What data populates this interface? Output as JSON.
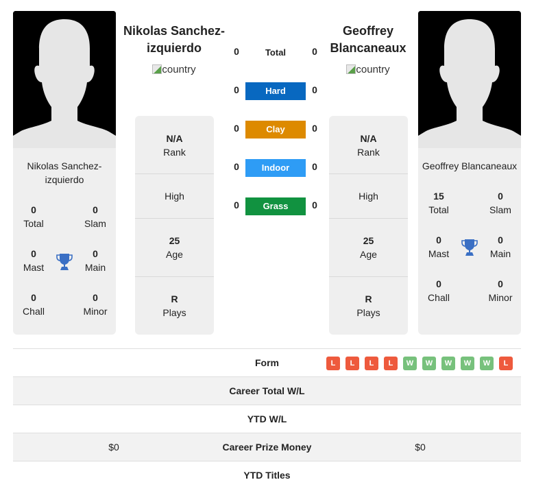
{
  "player1": {
    "name": "Nikolas Sanchez-izquierdo",
    "name_line1": "Nikolas Sanchez-",
    "name_line2": "izquierdo",
    "country_alt": "country",
    "stats": {
      "total": {
        "value": "0",
        "label": "Total"
      },
      "slam": {
        "value": "0",
        "label": "Slam"
      },
      "mast": {
        "value": "0",
        "label": "Mast"
      },
      "main": {
        "value": "0",
        "label": "Main"
      },
      "chall": {
        "value": "0",
        "label": "Chall"
      },
      "minor": {
        "value": "0",
        "label": "Minor"
      }
    },
    "info": {
      "rank": {
        "value": "N/A",
        "label": "Rank"
      },
      "high": {
        "value": "",
        "label": "High"
      },
      "age": {
        "value": "25",
        "label": "Age"
      },
      "plays": {
        "value": "R",
        "label": "Plays"
      }
    }
  },
  "player2": {
    "name": "Geoffrey Blancaneaux",
    "name_line1": "Geoffrey",
    "name_line2": "Blancaneaux",
    "country_alt": "country",
    "stats": {
      "total": {
        "value": "15",
        "label": "Total"
      },
      "slam": {
        "value": "0",
        "label": "Slam"
      },
      "mast": {
        "value": "0",
        "label": "Mast"
      },
      "main": {
        "value": "0",
        "label": "Main"
      },
      "chall": {
        "value": "0",
        "label": "Chall"
      },
      "minor": {
        "value": "0",
        "label": "Minor"
      }
    },
    "info": {
      "rank": {
        "value": "N/A",
        "label": "Rank"
      },
      "high": {
        "value": "",
        "label": "High"
      },
      "age": {
        "value": "25",
        "label": "Age"
      },
      "plays": {
        "value": "R",
        "label": "Plays"
      }
    }
  },
  "h2h": {
    "total": {
      "label": "Total",
      "p1": "0",
      "p2": "0"
    },
    "surfaces": [
      {
        "label": "Hard",
        "p1": "0",
        "p2": "0",
        "color": "#0868c0"
      },
      {
        "label": "Clay",
        "p1": "0",
        "p2": "0",
        "color": "#dd8a00"
      },
      {
        "label": "Indoor",
        "p1": "0",
        "p2": "0",
        "color": "#2e9cf5"
      },
      {
        "label": "Grass",
        "p1": "0",
        "p2": "0",
        "color": "#119240"
      }
    ]
  },
  "comparison": {
    "form": {
      "label": "Form",
      "results": [
        "L",
        "L",
        "L",
        "L",
        "W",
        "W",
        "W",
        "W",
        "W",
        "L"
      ]
    },
    "career_total_wl": {
      "label": "Career Total W/L",
      "p1": "",
      "p2": ""
    },
    "ytd_wl": {
      "label": "YTD W/L",
      "p1": "",
      "p2": ""
    },
    "career_prize_money": {
      "label": "Career Prize Money",
      "p1": "$0",
      "p2": "$0"
    },
    "ytd_titles": {
      "label": "YTD Titles",
      "p1": "",
      "p2": ""
    }
  },
  "colors": {
    "win": "#77c17c",
    "loss": "#ee5a3d",
    "trophy": "#3a6fc4"
  }
}
